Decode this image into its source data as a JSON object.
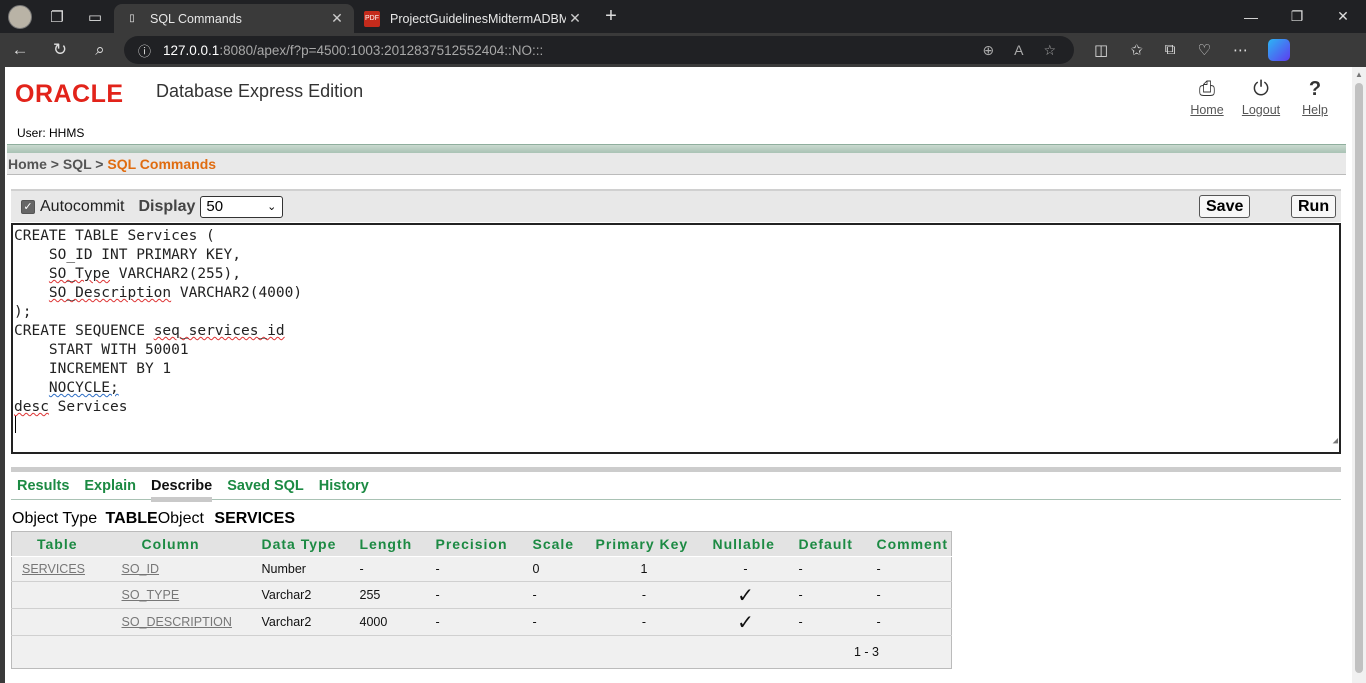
{
  "browser": {
    "tabs": [
      {
        "title": "SQL Commands",
        "active": true
      },
      {
        "title": "ProjectGuidelinesMidtermADBMS",
        "active": false
      }
    ],
    "url_host": "127.0.0.1",
    "url_rest": ":8080/apex/f?p=4500:1003:2012837512552404::NO:::"
  },
  "header": {
    "logo": "ORACLE",
    "product": "Database Express Edition",
    "user": "User: HHMS",
    "links": [
      {
        "label": "Home",
        "icon": "home-icon"
      },
      {
        "label": "Logout",
        "icon": "power-icon"
      },
      {
        "label": "Help",
        "icon": "question-icon"
      }
    ]
  },
  "breadcrumb": {
    "home": "Home",
    "sep1": " > ",
    "sql": "SQL",
    "sep2": " > ",
    "current": "SQL Commands"
  },
  "toolbar": {
    "autocommit_label": "Autocommit",
    "autocommit_checked": true,
    "display_label": "Display",
    "display_value": "50",
    "save_label": "Save",
    "run_label": "Run"
  },
  "editor": {
    "line1": "CREATE TABLE Services (",
    "line2": "    SO_ID INT PRIMARY KEY,",
    "line3a": "    ",
    "line3b": "SO_Type",
    "line3c": " VARCHAR2(255),",
    "line4a": "    ",
    "line4b": "SO_Description",
    "line4c": " VARCHAR2(4000)",
    "line5": ");",
    "line6a": "CREATE SEQUENCE ",
    "line6b": "seq_services_id",
    "line7": "    START WITH 50001",
    "line8": "    INCREMENT BY 1",
    "line9a": "    ",
    "line9b": "NOCYCLE;",
    "line10a": "desc",
    "line10b": " Services"
  },
  "result_tabs": [
    "Results",
    "Explain",
    "Describe",
    "Saved SQL",
    "History"
  ],
  "active_tab": "Describe",
  "object_info": {
    "type_label": "Object Type",
    "type_value": "TABLE",
    "object_label": "Object",
    "object_value": "SERVICES"
  },
  "describe_table": {
    "headers": [
      "Table",
      "Column",
      "Data Type",
      "Length",
      "Precision",
      "Scale",
      "Primary Key",
      "Nullable",
      "Default",
      "Comment"
    ],
    "rows": [
      {
        "table": "SERVICES",
        "column": "SO_ID",
        "type": "Number",
        "length": "-",
        "precision": "-",
        "scale": "0",
        "pk": "1",
        "nullable": "-",
        "default": "-",
        "comment": "-"
      },
      {
        "table": "",
        "column": "SO_TYPE",
        "type": "Varchar2",
        "length": "255",
        "precision": "-",
        "scale": "-",
        "pk": "-",
        "nullable": "✓",
        "default": "-",
        "comment": "-"
      },
      {
        "table": "",
        "column": "SO_DESCRIPTION",
        "type": "Varchar2",
        "length": "4000",
        "precision": "-",
        "scale": "-",
        "pk": "-",
        "nullable": "✓",
        "default": "-",
        "comment": "-"
      }
    ],
    "pagination": "1 - 3"
  }
}
